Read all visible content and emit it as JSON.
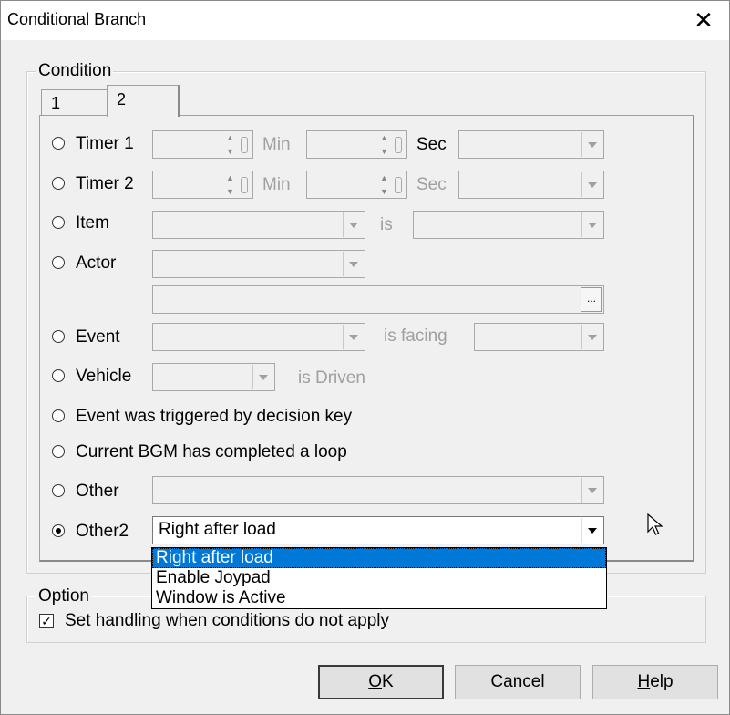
{
  "window": {
    "title": "Conditional Branch",
    "close_label": "✕"
  },
  "condition": {
    "legend": "Condition",
    "tabs": [
      {
        "label": "1"
      },
      {
        "label": "2"
      }
    ],
    "rows": {
      "timer1": {
        "label": "Timer 1",
        "min": "Min",
        "sec": "Sec"
      },
      "timer2": {
        "label": "Timer 2",
        "min": "Min",
        "sec": "Sec"
      },
      "item": {
        "label": "Item",
        "is": "is"
      },
      "actor": {
        "label": "Actor",
        "ellipsis": "..."
      },
      "event": {
        "label": "Event",
        "is_facing": "is facing"
      },
      "vehicle": {
        "label": "Vehicle",
        "is_driven": "is Driven"
      },
      "decision_key": {
        "label": "Event was triggered by decision key"
      },
      "bgm_loop": {
        "label": "Current BGM has completed a loop"
      },
      "other": {
        "label": "Other"
      },
      "other2": {
        "label": "Other2",
        "selected": "Right after load"
      }
    },
    "dropdown_options": [
      "Right after load",
      "Enable Joypad",
      "Window is Active"
    ]
  },
  "option": {
    "legend": "Option",
    "checkbox_label": "Set handling when conditions do not apply",
    "checked_mark": "✓"
  },
  "buttons": {
    "ok": {
      "mnemonic": "O",
      "rest": "K"
    },
    "cancel": {
      "label": "Cancel"
    },
    "help": {
      "mnemonic": "H",
      "rest": "elp"
    }
  }
}
